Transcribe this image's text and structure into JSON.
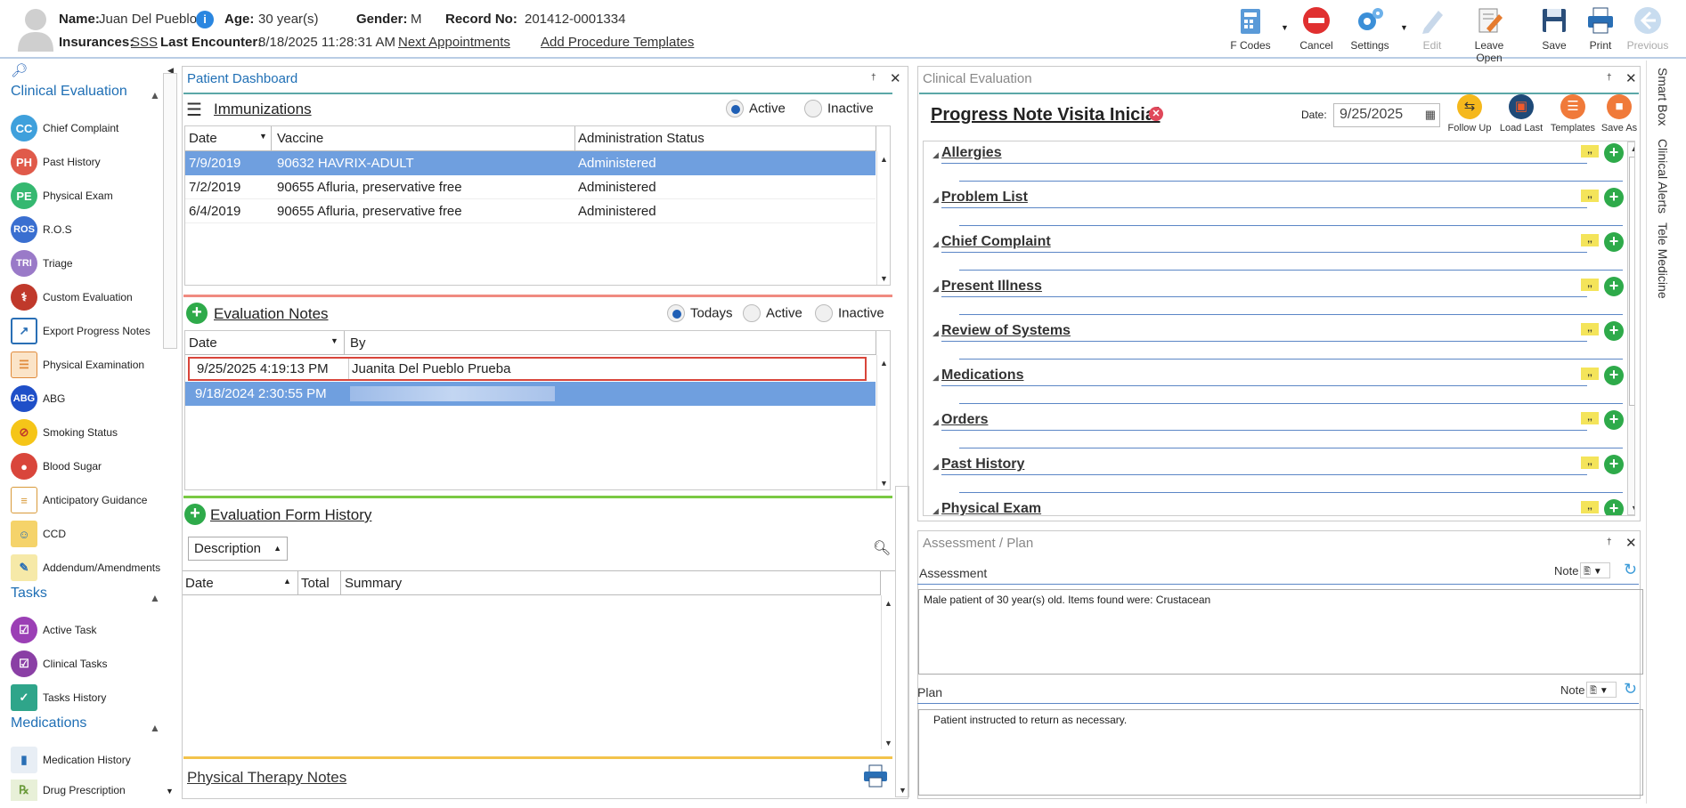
{
  "header": {
    "name_label": "Name:",
    "name_value": "Juan Del Pueblo",
    "age_label": "Age:",
    "age_value": "30 year(s)",
    "gender_label": "Gender:",
    "gender_value": "M",
    "record_label": "Record No:",
    "record_value": "201412-0001334",
    "insurances_label": "Insurances:",
    "insurances_value": "SSS",
    "last_encounter_label": "Last Encounter:",
    "last_encounter_value": "8/18/2025 11:28:31 AM",
    "next_appointments": "Next Appointments",
    "add_procedure_templates": "Add Procedure Templates"
  },
  "toolbar": {
    "fcodes": "F Codes",
    "cancel": "Cancel",
    "settings": "Settings",
    "edit": "Edit",
    "leave_open": "Leave Open",
    "save": "Save",
    "print": "Print",
    "previous": "Previous"
  },
  "leftnav": {
    "clinical_evaluation": "Clinical Evaluation",
    "items": [
      {
        "label": "Chief Complaint",
        "icon": "CC"
      },
      {
        "label": "Past History",
        "icon": "PH"
      },
      {
        "label": "Physical Exam",
        "icon": "PE"
      },
      {
        "label": "R.O.S",
        "icon": "ROS"
      },
      {
        "label": "Triage",
        "icon": "TRI"
      },
      {
        "label": "Custom Evaluation",
        "icon": "stethoscope-icon"
      },
      {
        "label": "Export Progress Notes",
        "icon": "export-icon"
      },
      {
        "label": "Physical Examination",
        "icon": "clipboard-icon"
      },
      {
        "label": "ABG",
        "icon": "ABG"
      },
      {
        "label": "Smoking Status",
        "icon": "smoking-icon"
      },
      {
        "label": "Blood Sugar",
        "icon": "blood-drop-icon"
      },
      {
        "label": "Anticipatory Guidance",
        "icon": "guidance-icon"
      },
      {
        "label": "CCD",
        "icon": "folder-icon"
      },
      {
        "label": "Addendum/Amendments",
        "icon": "document-icon"
      }
    ],
    "tasks": "Tasks",
    "task_items": [
      {
        "label": "Active Task"
      },
      {
        "label": "Clinical Tasks"
      },
      {
        "label": "Tasks History"
      }
    ],
    "medications": "Medications",
    "med_items": [
      {
        "label": "Medication History"
      },
      {
        "label": "Drug Prescription"
      }
    ]
  },
  "dashboard": {
    "title": "Patient Dashboard",
    "immunizations": {
      "title": "Immunizations",
      "active": "Active",
      "inactive": "Inactive",
      "columns": [
        "Date",
        "Vaccine",
        "Administration Status"
      ],
      "rows": [
        [
          "7/9/2019",
          "90632 HAVRIX-ADULT",
          "Administered"
        ],
        [
          "7/2/2019",
          "90655 Afluria, preservative free",
          "Administered"
        ],
        [
          "6/4/2019",
          "90655 Afluria, preservative free",
          "Administered"
        ]
      ]
    },
    "evaluation_notes": {
      "title": "Evaluation Notes",
      "todays": "Todays",
      "active": "Active",
      "inactive": "Inactive",
      "columns": [
        "Date",
        "By"
      ],
      "rows": [
        [
          "9/25/2025 4:19:13 PM",
          "Juanita Del Pueblo Prueba"
        ],
        [
          "9/18/2024 2:30:55 PM",
          ""
        ]
      ]
    },
    "evaluation_form_history": {
      "title": "Evaluation Form History",
      "filter": "Description",
      "columns": [
        "Date",
        "Total",
        "Summary"
      ]
    },
    "physical_therapy": {
      "title": "Physical Therapy Notes"
    }
  },
  "clinical_eval": {
    "title": "Clinical Evaluation",
    "note_title": "Progress Note Visita Inicial",
    "date_label": "Date:",
    "date_value": "9/25/2025",
    "actions": [
      "Follow Up",
      "Load Last",
      "Templates",
      "Save As"
    ],
    "sections": [
      "Allergies",
      "Problem List",
      "Chief Complaint",
      "Present Illness",
      "Review of Systems",
      "Medications",
      "Orders",
      "Past History",
      "Physical Exam"
    ]
  },
  "assessment_plan": {
    "title": "Assessment / Plan",
    "assessment_label": "Assessment",
    "note_label": "Note",
    "assessment_text": "Male patient of 30 year(s) old. Items found were:  Crustacean",
    "plan_label": "Plan",
    "plan_text": "Patient instructed to return as necessary."
  },
  "side_tabs": [
    "Smart Box",
    "Clinical Alerts",
    "Tele Medicine"
  ]
}
